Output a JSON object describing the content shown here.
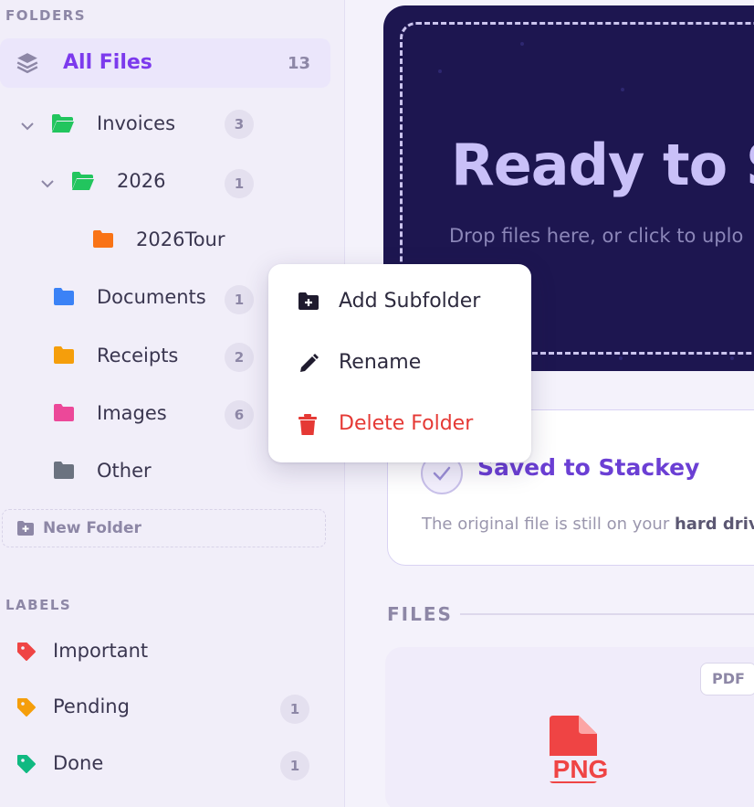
{
  "sidebar": {
    "folders_title": "FOLDERS",
    "all_files": {
      "label": "All Files",
      "count": "13",
      "icon": "stack-icon"
    },
    "folders": [
      {
        "name": "Invoices",
        "count": "3",
        "expanded": true,
        "color": "#22c55e",
        "icon": "folder-open-icon"
      },
      {
        "name": "2026",
        "count": "1",
        "expanded": true,
        "color": "#22c55e",
        "icon": "folder-open-icon"
      },
      {
        "name": "2026Tour",
        "count": "",
        "color": "#f97316",
        "icon": "folder-icon"
      },
      {
        "name": "Documents",
        "count": "1",
        "color": "#3b82f6",
        "icon": "folder-icon"
      },
      {
        "name": "Receipts",
        "count": "2",
        "color": "#f59e0b",
        "icon": "folder-icon"
      },
      {
        "name": "Images",
        "count": "6",
        "color": "#ec4899",
        "icon": "folder-icon"
      },
      {
        "name": "Other",
        "count": "",
        "color": "#6b7280",
        "icon": "folder-icon"
      }
    ],
    "new_folder_label": "New Folder",
    "labels_title": "LABELS",
    "labels": [
      {
        "name": "Important",
        "count": "",
        "color": "#ef4444"
      },
      {
        "name": "Pending",
        "count": "1",
        "color": "#f59e0b"
      },
      {
        "name": "Done",
        "count": "1",
        "color": "#10b981"
      }
    ]
  },
  "hero": {
    "title": "Ready to Sta",
    "subtitle": "Drop files here, or click to uplo"
  },
  "saved_card": {
    "title": "Saved to Stackey",
    "desc_prefix": "The original file is still on your ",
    "desc_bold": "hard driv"
  },
  "files": {
    "title": "FILES",
    "card": {
      "chip": "PDF",
      "icon_label": "PNG",
      "icon_color": "#ef4444"
    }
  },
  "context_menu": {
    "items": [
      {
        "label": "Add Subfolder",
        "icon": "folder-plus-icon"
      },
      {
        "label": "Rename",
        "icon": "pencil-icon"
      },
      {
        "label": "Delete Folder",
        "icon": "trash-icon",
        "color": "#e53935"
      }
    ]
  },
  "colors": {
    "accent": "#7c3aed",
    "hero_bg": "#1d1650",
    "danger": "#e53935"
  }
}
